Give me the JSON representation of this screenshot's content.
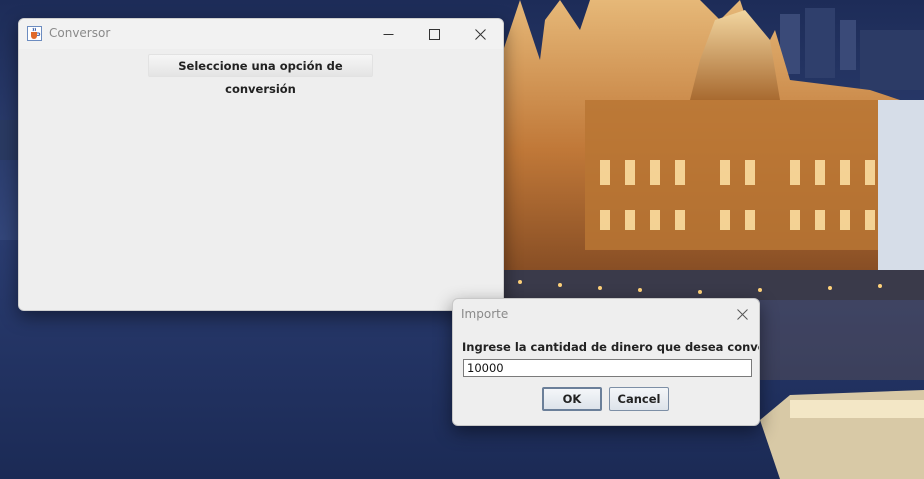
{
  "main_window": {
    "title": "Conversor",
    "convert_button_label": "Seleccione una opción de conversión"
  },
  "dialog": {
    "title": "Importe",
    "prompt": "Ingrese la cantidad de dinero que desea convertir:",
    "input_value": "10000",
    "ok_label": "OK",
    "cancel_label": "Cancel"
  },
  "icons": {
    "app": "java-cup-icon",
    "minimize": "minimize-icon",
    "maximize": "maximize-icon",
    "close": "close-icon"
  },
  "colors": {
    "window_bg": "#eeeeee",
    "title_text": "#8a8a8a",
    "button_border": "#7d8fa6"
  }
}
